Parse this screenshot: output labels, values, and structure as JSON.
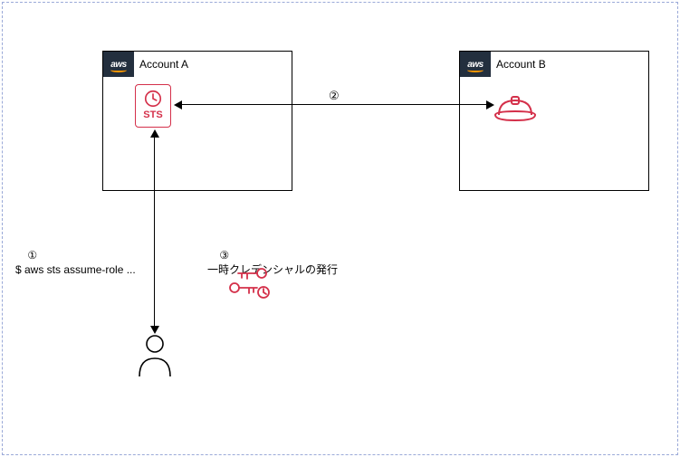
{
  "aws_badge_text": "aws",
  "accounts": {
    "a": {
      "label": "Account A"
    },
    "b": {
      "label": "Account B"
    }
  },
  "sts": {
    "label": "STS"
  },
  "steps": {
    "one": {
      "marker": "①",
      "text": "$ aws sts assume-role ..."
    },
    "two": {
      "marker": "②"
    },
    "three": {
      "marker": "③",
      "text": "一時クレデンシャルの発行"
    }
  }
}
